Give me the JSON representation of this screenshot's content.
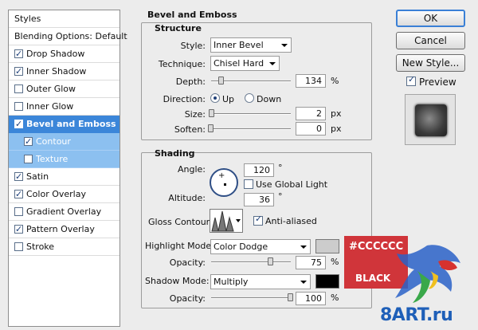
{
  "styles_list": {
    "header": "Styles",
    "blending": "Blending Options: Default",
    "items": [
      {
        "label": "Drop Shadow",
        "checked": true
      },
      {
        "label": "Inner Shadow",
        "checked": true
      },
      {
        "label": "Outer Glow",
        "checked": false
      },
      {
        "label": "Inner Glow",
        "checked": false
      },
      {
        "label": "Bevel and Emboss",
        "checked": true,
        "selected": true
      },
      {
        "label": "Contour",
        "checked": true,
        "sub": true
      },
      {
        "label": "Texture",
        "checked": false,
        "sub": true
      },
      {
        "label": "Satin",
        "checked": true
      },
      {
        "label": "Color Overlay",
        "checked": true
      },
      {
        "label": "Gradient Overlay",
        "checked": false
      },
      {
        "label": "Pattern Overlay",
        "checked": true
      },
      {
        "label": "Stroke",
        "checked": false
      }
    ]
  },
  "bevel": {
    "title": "Bevel and Emboss",
    "structure": {
      "title": "Structure",
      "style_label": "Style:",
      "style_value": "Inner Bevel",
      "technique_label": "Technique:",
      "technique_value": "Chisel Hard",
      "depth_label": "Depth:",
      "depth_value": "134",
      "depth_unit": "%",
      "depth_level": 0.13,
      "direction_label": "Direction:",
      "direction_up": "Up",
      "direction_down": "Down",
      "size_label": "Size:",
      "size_value": "2",
      "size_unit": "px",
      "size_level": 0.01,
      "soften_label": "Soften:",
      "soften_value": "0",
      "soften_unit": "px",
      "soften_level": 0.0
    },
    "shading": {
      "title": "Shading",
      "angle_label": "Angle:",
      "angle_value": "120",
      "angle_unit": "°",
      "global_light_label": "Use Global Light",
      "global_light_checked": false,
      "altitude_label": "Altitude:",
      "altitude_value": "36",
      "altitude_unit": "°",
      "gloss_label": "Gloss Contour:",
      "anti_aliased_label": "Anti-aliased",
      "anti_aliased_checked": true,
      "highlight_mode_label": "Highlight Mode:",
      "highlight_mode_value": "Color Dodge",
      "highlight_color": "#CCCCCC",
      "hl_opacity_label": "Opacity:",
      "hl_opacity_value": "75",
      "hl_opacity_unit": "%",
      "hl_opacity_level": 0.75,
      "shadow_mode_label": "Shadow Mode:",
      "shadow_mode_value": "Multiply",
      "shadow_color": "#000000",
      "sh_opacity_label": "Opacity:",
      "sh_opacity_value": "100",
      "sh_opacity_unit": "%",
      "sh_opacity_level": 1.0
    }
  },
  "buttons": {
    "ok": "OK",
    "cancel": "Cancel",
    "new_style": "New Style...",
    "preview_label": "Preview",
    "preview_checked": true
  },
  "annotation": {
    "line1": "#CCCCCC",
    "line2": "BLACK"
  },
  "watermark": "8ART.ru"
}
